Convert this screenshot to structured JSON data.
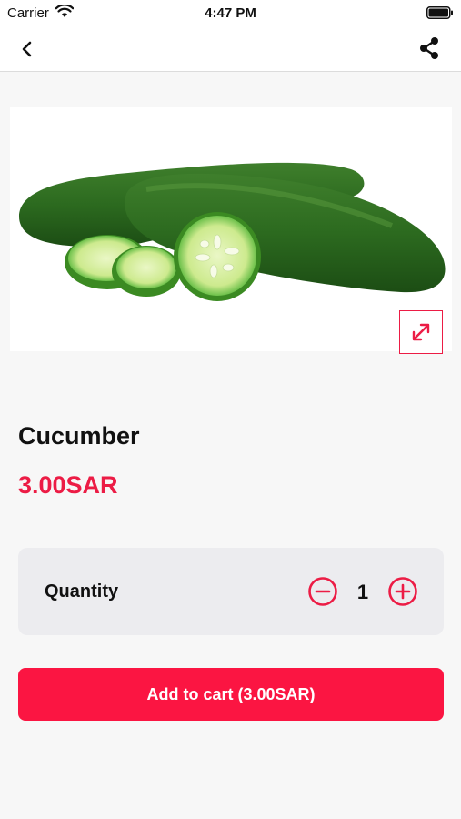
{
  "status_bar": {
    "carrier": "Carrier",
    "time": "4:47 PM",
    "wifi_icon": "wifi-icon",
    "battery_icon": "battery-full-icon"
  },
  "nav": {
    "back_icon": "chevron-left-icon",
    "share_icon": "share-icon"
  },
  "product": {
    "image": "cucumber-photo",
    "expand_icon": "expand-arrows-icon",
    "name": "Cucumber",
    "price": "3.00SAR"
  },
  "quantity": {
    "label": "Quantity",
    "value": "1",
    "decrease_icon": "minus-circle-icon",
    "increase_icon": "plus-circle-icon"
  },
  "cart": {
    "button_label": "Add to cart (3.00SAR)"
  },
  "colors": {
    "accent": "#ec1c45",
    "button": "#fb1542",
    "background": "#f7f7f7",
    "card": "#ececef"
  }
}
